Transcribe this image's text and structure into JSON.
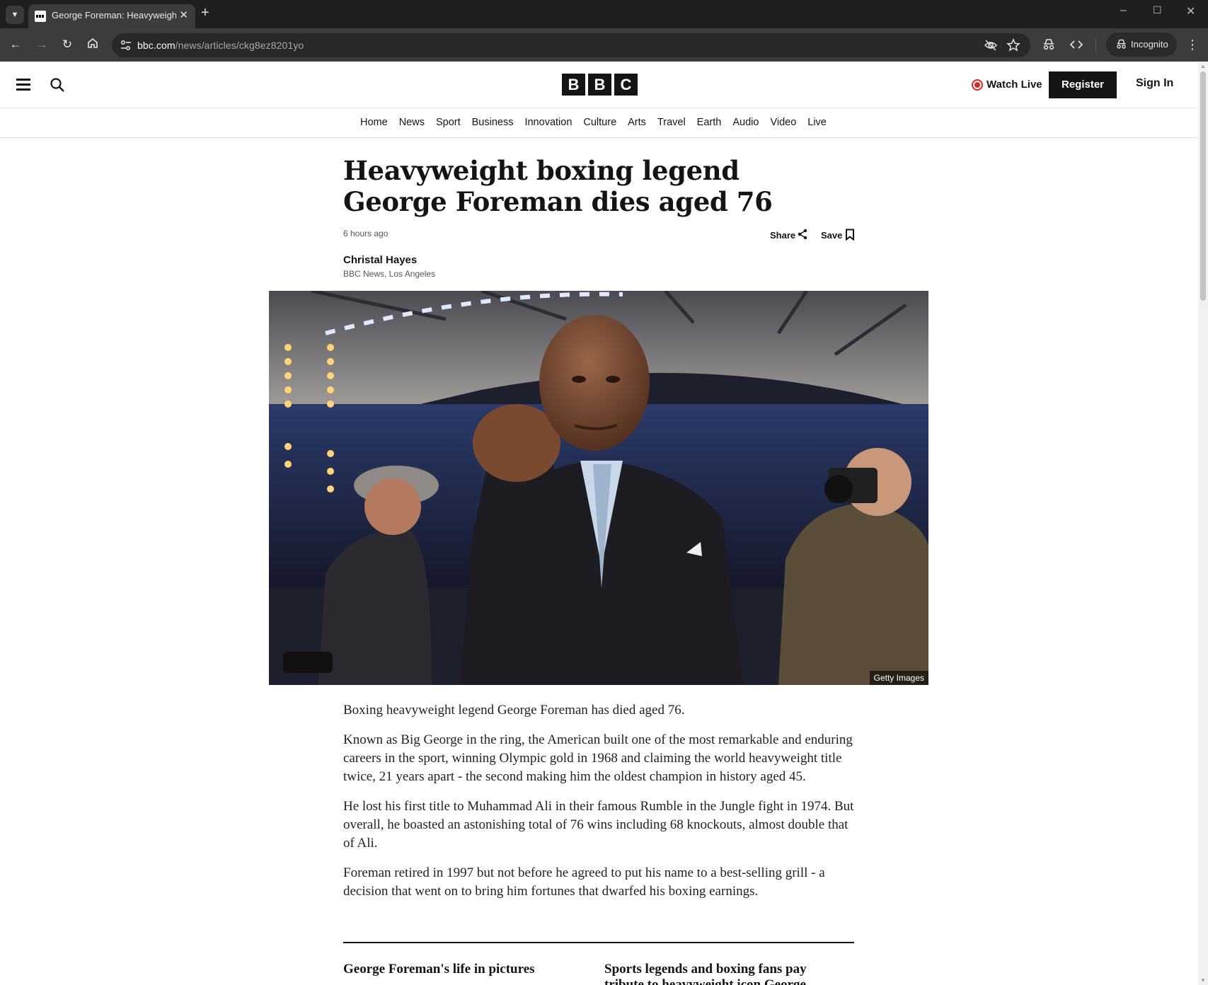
{
  "browser": {
    "tab_title": "George Foreman: Heavyweight",
    "url_host": "bbc.com",
    "url_path": "/news/articles/ckg8ez8201yo",
    "incognito_label": "Incognito"
  },
  "header": {
    "logo_letters": [
      "B",
      "B",
      "C"
    ],
    "watch_live": "Watch Live",
    "register": "Register",
    "sign_in": "Sign In"
  },
  "nav": {
    "items": [
      "Home",
      "News",
      "Sport",
      "Business",
      "Innovation",
      "Culture",
      "Arts",
      "Travel",
      "Earth",
      "Audio",
      "Video",
      "Live"
    ]
  },
  "article": {
    "headline": "Heavyweight boxing legend George Foreman dies aged 76",
    "timestamp": "6 hours ago",
    "share_label": "Share",
    "save_label": "Save",
    "author": "Christal Hayes",
    "author_role": "BBC News, Los Angeles",
    "image_credit": "Getty Images",
    "paragraphs": [
      "Boxing heavyweight legend George Foreman has died aged 76.",
      "Known as Big George in the ring, the American built one of the most remarkable and enduring careers in the sport, winning Olympic gold in 1968 and claiming the world heavyweight title twice, 21 years apart - the second making him the oldest champion in history aged 45.",
      "He lost his first title to Muhammad Ali in their famous Rumble in the Jungle fight in 1974. But overall, he boasted an astonishing total of 76 wins including 68 knockouts, almost double that of Ali.",
      "Foreman retired in 1997 but not before he agreed to put his name to a best-selling grill - a decision that went on to bring him fortunes that dwarfed his boxing earnings."
    ],
    "related": [
      "George Foreman's life in pictures",
      "Sports legends and boxing fans pay tribute to heavyweight icon George"
    ]
  },
  "colors": {
    "live_red": "#d42a20",
    "brand_black": "#141414"
  }
}
